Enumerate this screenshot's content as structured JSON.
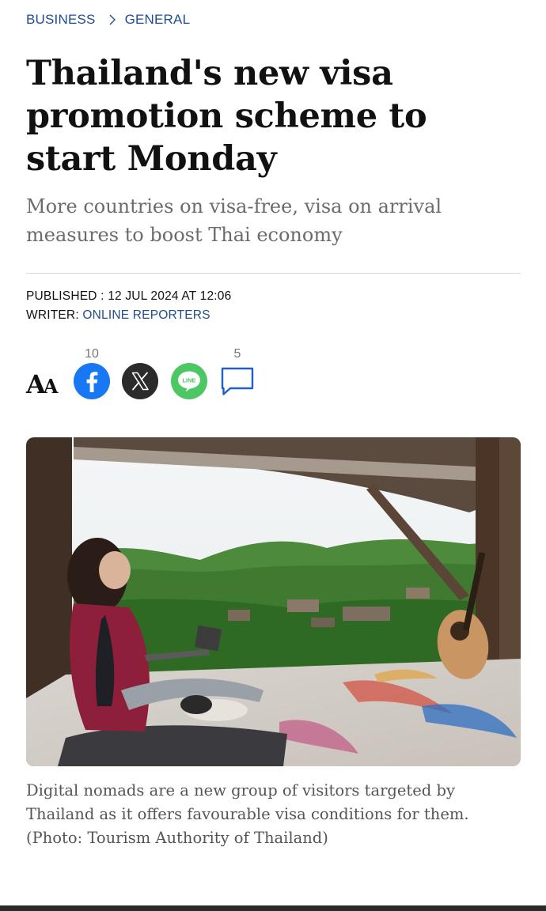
{
  "breadcrumb": {
    "section": "BUSINESS",
    "subsection": "GENERAL"
  },
  "article": {
    "title": "Thailand's new visa promotion scheme to start Monday",
    "subtitle": "More countries on visa-free, visa on arrival measures to boost Thai economy",
    "published_label": "PUBLISHED : ",
    "published_value": "12 JUL 2024 AT 12:06",
    "writer_label": "WRITER: ",
    "writer_value": "ONLINE REPORTERS",
    "caption": "Digital nomads are a new group of visitors targeted by Thailand as it offers favourable visa conditions for them. (Photo: Tourism Authority of Thailand)"
  },
  "toolbar": {
    "font_size_big": "A",
    "font_size_small": "A",
    "facebook_count": "10",
    "comment_count": "5",
    "line_label": "LINE"
  },
  "colors": {
    "link_blue": "#1f4e8c",
    "facebook_blue": "#1877f2",
    "x_dark": "#2b2b2b",
    "line_green": "#4cc764",
    "comment_blue": "#1f5fd1"
  },
  "photo": {
    "description_icon": "photo-image"
  }
}
